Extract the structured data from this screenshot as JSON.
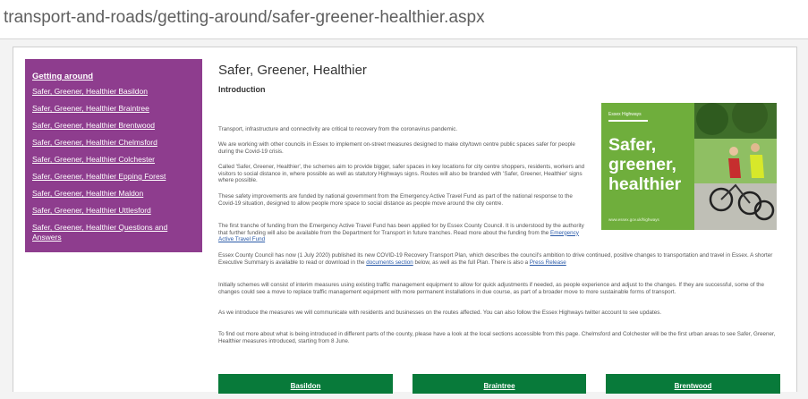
{
  "browser": {
    "url": "transport-and-roads/getting-around/safer-greener-healthier.aspx"
  },
  "sidebar": {
    "heading": "Getting around",
    "links": [
      "Safer, Greener, Healthier Basildon",
      "Safer, Greener, Healthier Braintree",
      "Safer, Greener, Healthier Brentwood",
      "Safer, Greener, Healthier Chelmsford",
      "Safer, Greener, Healthier Colchester",
      "Safer, Greener, Healthier Epping Forest",
      "Safer, Greener, Healthier Maldon",
      "Safer, Greener, Healthier Uttlesford",
      "Safer, Greener, Healthier Questions and Answers"
    ]
  },
  "main": {
    "title": "Safer, Greener, Healthier",
    "subheading": "Introduction",
    "p1": "Transport, infrastructure and connectivity are critical to recovery from the coronavirus pandemic.",
    "p2": "We are working with other councils in Essex to implement on-street measures designed to make city/town centre public spaces safer for people during the Covid-19 crisis.",
    "p3": "Called 'Safer, Greener, Healthier', the schemes aim to provide bigger, safer spaces in key locations for city centre shoppers, residents, workers and visitors to social distance in, where possible as well as statutory Highways signs. Routes will also be branded with 'Safer, Greener, Healthier' signs where possible.",
    "p4": "These safety improvements are funded by national government from the Emergency Active Travel Fund as part of the national response to the Covid-19 situation, designed to allow people more space to social distance as people move around the city centre.",
    "p5_text": "The first tranche of funding from the Emergency Active Travel Fund has been applied for by Essex County Council. It is understood by the authority that further funding will also be available from the Department for Transport in future tranches. Read more about the funding from the ",
    "p5_link": "Emergency Active Travel Fund",
    "p6_text1": "Essex County Council has now (1 July 2020) published its new COVID-19 Recovery Transport Plan, which describes the council's ambition to drive continued, positive changes to transportation and travel in Essex. A shorter Executive Summary is available to read or download in the ",
    "p6_link1": "documents section",
    "p6_text2": " below, as well as the full Plan. There is also a ",
    "p6_link2": "Press Release",
    "p7": "Initially schemes will consist of interim measures using existing traffic management equipment to allow for quick adjustments if needed, as people experience and adjust to the changes. If they are successful, some of the changes could see a move to replace traffic management equipment with more permanent installations in due course, as part of a broader move to more sustainable forms of transport.",
    "p8": "As we introduce the measures we will communicate with residents and businesses on the routes affected. You can also follow the Essex Highways twitter account to see updates.",
    "p9": "To find out more about what is being introduced in different parts of the county, please have a look at the local sections accessible from this page. Chelmsford and Colchester will be the first urban areas to see Safer, Greener, Healthier measures introduced, starting from 8 June."
  },
  "promo": {
    "brand": "Essex Highways",
    "headline_1": "Safer,",
    "headline_2": "greener,",
    "headline_3": "healthier",
    "website": "www.essex.gov.uk/highways"
  },
  "buttons": [
    "Basildon",
    "Braintree",
    "Brentwood"
  ],
  "colors": {
    "sidebar": "#8e3d8e",
    "promo": "#6fae3c",
    "button": "#087a3a"
  }
}
